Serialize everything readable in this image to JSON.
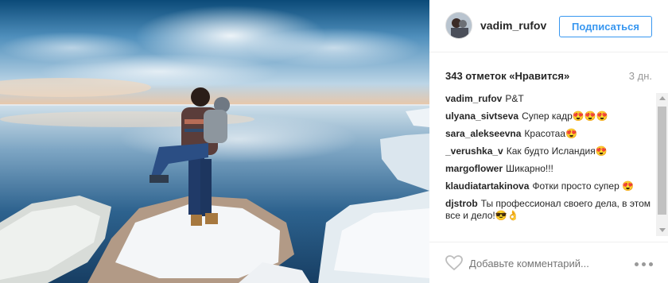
{
  "post": {
    "username": "vadim_rufov",
    "follow_label": "Подписаться",
    "likes_text": "343 отметок «Нравится»",
    "time_ago": "3 дн."
  },
  "comments": [
    {
      "author": "vadim_rufov",
      "text": "P&T"
    },
    {
      "author": "ulyana_sivtseva",
      "text": "Супер кадр😍😍😍"
    },
    {
      "author": "sara_alekseevna",
      "text": "Красотаа😍"
    },
    {
      "author": "_verushka_v",
      "text": "Как будто Исландия😍"
    },
    {
      "author": "margoflower",
      "text": "Шикарно!!!"
    },
    {
      "author": "klaudiatartakinova",
      "text": "Фотки просто супер 😍"
    },
    {
      "author": "djstrob",
      "text": "Ты профессионал своего дела, в этом все и дело!😎👌"
    }
  ],
  "comment_box": {
    "placeholder": "Добавьте комментарий..."
  },
  "icons": {
    "like": "heart-icon",
    "options": "more-options-icon"
  }
}
